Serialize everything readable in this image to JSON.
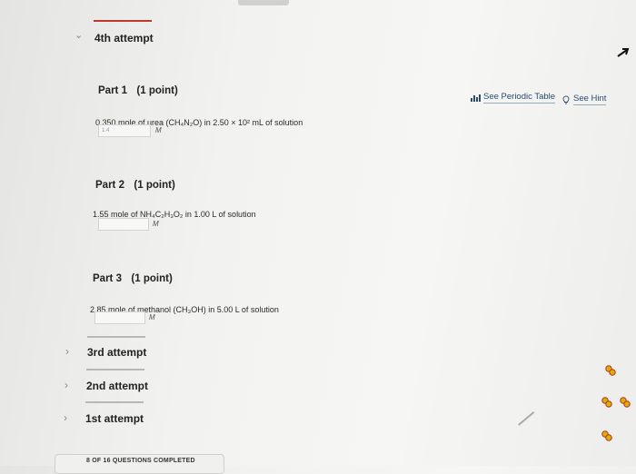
{
  "attempts": {
    "current_label": "4th attempt",
    "third_label": "3rd attempt",
    "second_label": "2nd attempt",
    "first_label": "1st attempt"
  },
  "tools": {
    "periodic_table_label": "See Periodic Table",
    "hint_label": "See Hint"
  },
  "parts": [
    {
      "title": "Part 1",
      "points": "(1 point)",
      "question_text": "0.350 mole of urea (CH₄N₂O) in 2.50 × 10² mL of solution",
      "answer_value": "1.4",
      "unit": "M"
    },
    {
      "title": "Part 2",
      "points": "(1 point)",
      "question_text": "1.55 mole of NH₄C₂H₃O₂ in 1.00 L of solution",
      "answer_value": "",
      "unit": "M"
    },
    {
      "title": "Part 3",
      "points": "(1 point)",
      "question_text": "2.85 mole of methanol (CH₃OH) in 5.00 L of solution",
      "answer_value": "",
      "unit": "M"
    }
  ],
  "footer": {
    "progress_text": "8 OF 16 QUESTIONS COMPLETED"
  },
  "colors": {
    "accent_red": "#c0392b",
    "status_icon_fill": "#d8b400",
    "status_icon_stroke": "#c0392b"
  }
}
